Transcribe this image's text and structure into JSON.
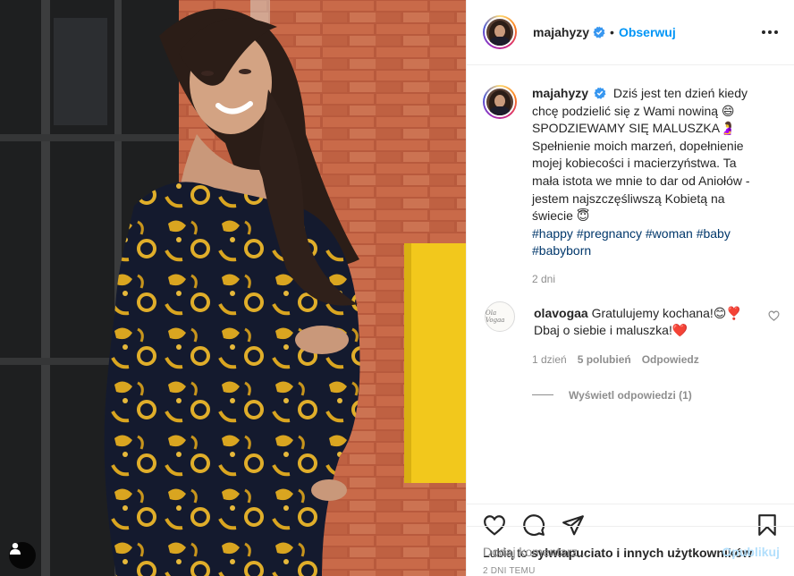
{
  "post": {
    "author": "majahyzy",
    "verified": true,
    "follow_label": "Obserwuj",
    "dot": "•",
    "more_icon": "more-horizontal-icon"
  },
  "caption": {
    "username": "majahyzy",
    "text": "Dziś jest ten dzień kiedy chcę podzielić się z Wami nowiną 😄 SPODZIEWAMY SIĘ MALUSZKA🤰 Spełnienie moich marzeń, dopełnienie mojej kobiecości i macierzyństwa. Ta mała istota we mnie to dar od Aniołów - jestem najszczęśliwszą Kobietą na świecie 😇",
    "hashtags": [
      "#happy",
      "#pregnancy",
      "#woman",
      "#baby",
      "#babyborn"
    ],
    "time": "2 dni"
  },
  "comments": [
    {
      "username": "olavogaa",
      "avatar_text": "Ola Vogaa",
      "text": "Gratulujemy kochana!😊❣️ Dbaj o siebie i maluszka!❤️",
      "time": "1 dzień",
      "likes": "5 polubień",
      "reply_label": "Odpowiedz",
      "view_replies": "Wyświetl odpowiedzi (1)"
    }
  ],
  "likes": {
    "prefix": "Lubią to",
    "user": "sylwiapuciato",
    "suffix": "i innych użytkowników"
  },
  "posted": "2 DNI TEMU",
  "add_comment": {
    "placeholder": "Dodaj komentarz...",
    "publish_label": "Opublikuj"
  },
  "colors": {
    "link": "#0095f6",
    "hashtag": "#00376b",
    "muted": "#8e8e8e",
    "text": "#262626"
  }
}
